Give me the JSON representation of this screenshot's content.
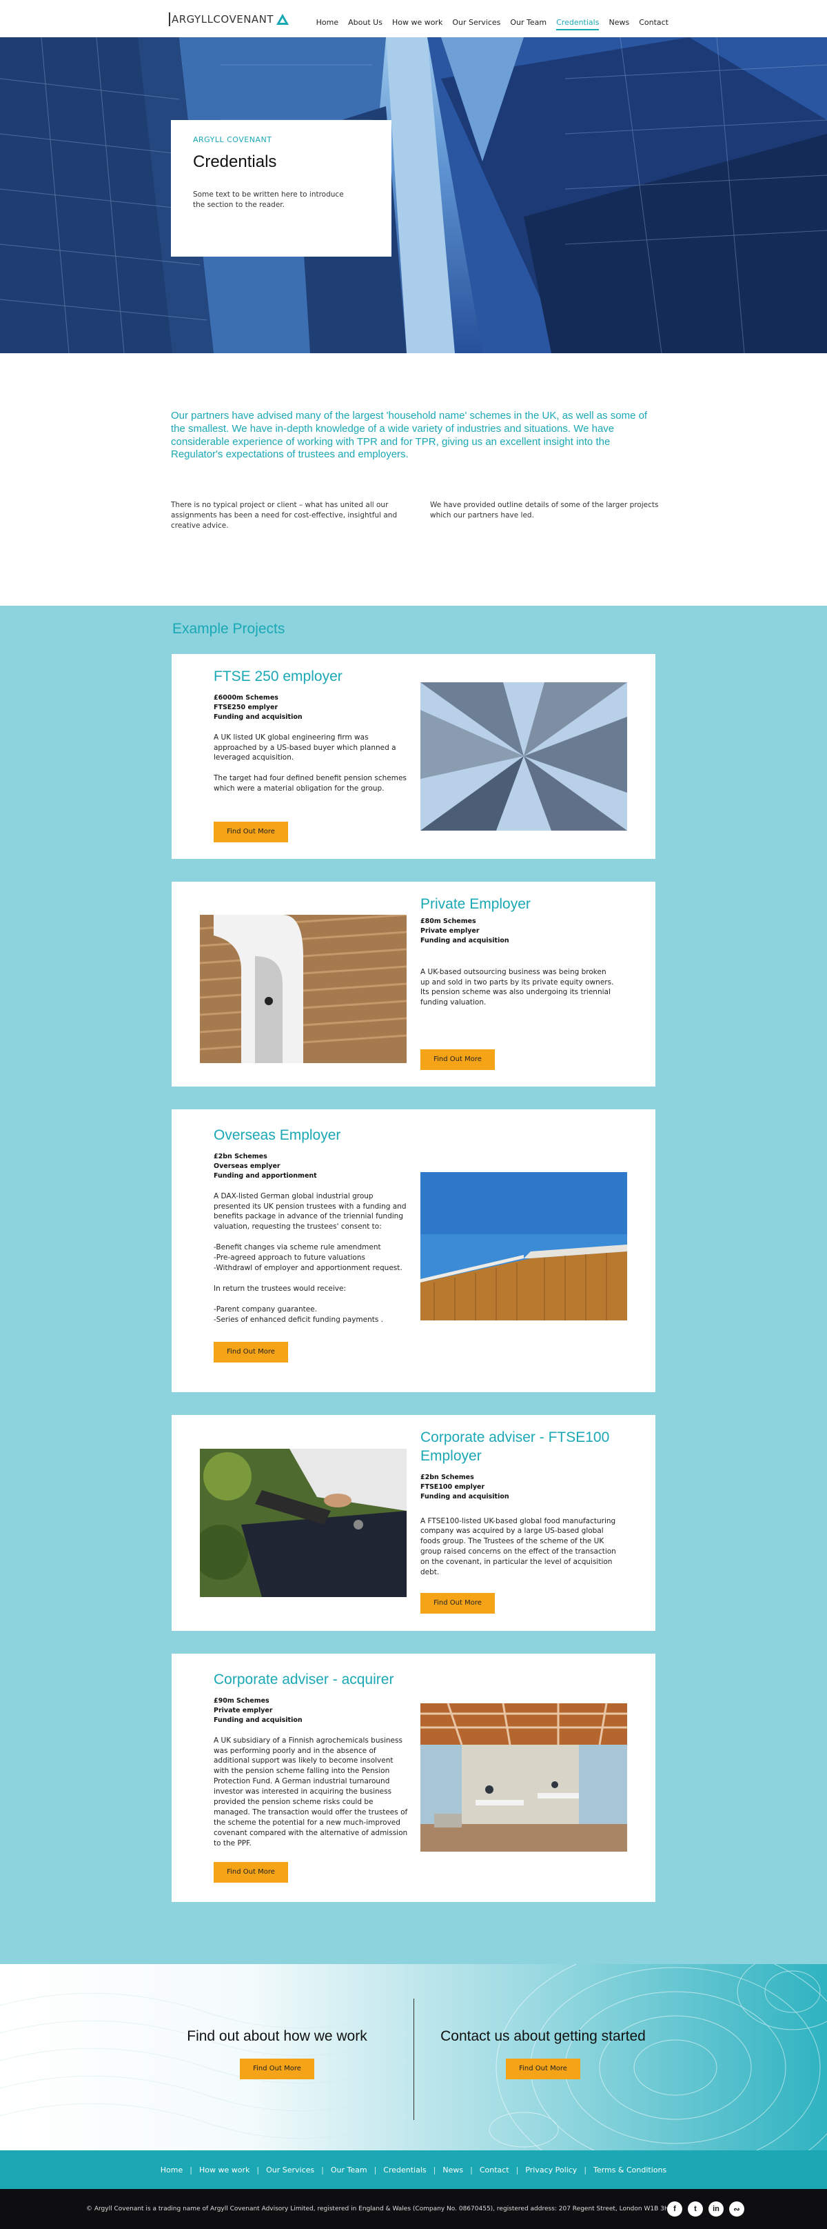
{
  "header": {
    "logo_text": "ARGYLLCOVENANT",
    "nav": [
      "Home",
      "About Us",
      "How we work",
      "Our Services",
      "Our Team",
      "Credentials",
      "News",
      "Contact"
    ],
    "active_nav": "Credentials"
  },
  "hero": {
    "kicker": "ARGYLL COVENANT",
    "title": "Credentials",
    "text": "Some text to be written here to introduce the section to the reader."
  },
  "intro": {
    "lead": "Our partners have advised many of the largest 'household name' schemes in the UK, as well as some of the smallest. We have in-depth knowledge of a wide variety of industries and situations. We have considerable experience of working with TPR and for TPR, giving us an excellent insight into the Regulator's expectations of trustees and employers.",
    "col1": "There is no typical project or client – what has united all our assignments has been a need for cost-effective, insightful and creative advice.",
    "col2": "We have provided outline details of some of the larger projects which our partners have led."
  },
  "projects": {
    "heading": "Example Projects",
    "items": [
      {
        "title": "FTSE 250 employer",
        "meta": [
          "£6000m Schemes",
          "FTSE250 emplyer",
          "Funding and acquisition"
        ],
        "desc": "A UK listed UK global engineering firm was approached by a US-based buyer which planned a leveraged acquisition.\n\nThe target had four defined benefit pension schemes which were a material obligation for the group.",
        "button": "Find Out More"
      },
      {
        "title": "Private Employer",
        "meta": [
          "£80m Schemes",
          "Private emplyer",
          "Funding and acquisition"
        ],
        "desc": "A UK-based outsourcing business was being broken up and sold in two parts by its private equity owners. Its pension scheme was also undergoing its triennial funding valuation.",
        "button": "Find Out More"
      },
      {
        "title": "Overseas Employer",
        "meta": [
          "£2bn Schemes",
          "Overseas emplyer",
          "Funding and apportionment"
        ],
        "desc": "A DAX-listed German global industrial group presented its UK pension trustees with a funding and benefits package in advance of the triennial funding valuation, requesting the trustees' consent to:\n\n-Benefit changes via scheme rule amendment\n-Pre-agreed approach to future valuations\n-Withdrawl of employer and apportionment request.\n\nIn return the trustees would receive:\n\n-Parent company guarantee.\n-Series of enhanced deficit funding payments .",
        "button": "Find Out More"
      },
      {
        "title": "Corporate adviser - FTSE100 Employer",
        "meta": [
          "£2bn Schemes",
          "FTSE100 emplyer",
          "Funding and acquisition"
        ],
        "desc": "A FTSE100-listed UK-based global food manufacturing company was acquired by a large US-based global foods group.  The Trustees of the scheme of the UK group raised concerns on the effect of the transaction on the covenant, in particular the level of acquisition debt.",
        "button": "Find Out More"
      },
      {
        "title": "Corporate adviser - acquirer",
        "meta": [
          "£90m Schemes",
          "Private emplyer",
          "Funding and acquisition"
        ],
        "desc": "A UK subsidiary of a Finnish agrochemicals business was performing poorly and in the absence of additional support was likely to become insolvent with the pension scheme falling into the Pension Protection Fund.  A German industrial turnaround investor was interested in acquiring the business provided the pension scheme risks could be managed.  The transaction would offer the trustees of the scheme the potential for a new much-improved covenant compared with the alternative of admission to the PPF.",
        "button": "Find Out More"
      }
    ]
  },
  "cta": {
    "left_title": "Find out about how we work",
    "left_button": "Find Out More",
    "right_title": "Contact us about getting started",
    "right_button": "Find Out More"
  },
  "footer": {
    "nav": [
      "Home",
      "How we work",
      "Our Services",
      "Our Team",
      "Credentials",
      "News",
      "Contact",
      "Privacy Policy",
      "Terms & Conditions"
    ],
    "legal": "© Argyll Covenant is a trading name of Argyll Covenant Advisory Limited, registered in England & Wales (Company No. 08670455), registered address: 207 Regent Street, London W1B 3HH",
    "social": [
      "facebook-icon",
      "twitter-icon",
      "linkedin-icon",
      "rss-icon"
    ]
  },
  "colors": {
    "accent": "#1aa8b5",
    "button": "#f5a317",
    "projects_bg": "#8dd3de",
    "footer_nav": "#1ba7b3",
    "footer_bar": "#0e0e10"
  }
}
